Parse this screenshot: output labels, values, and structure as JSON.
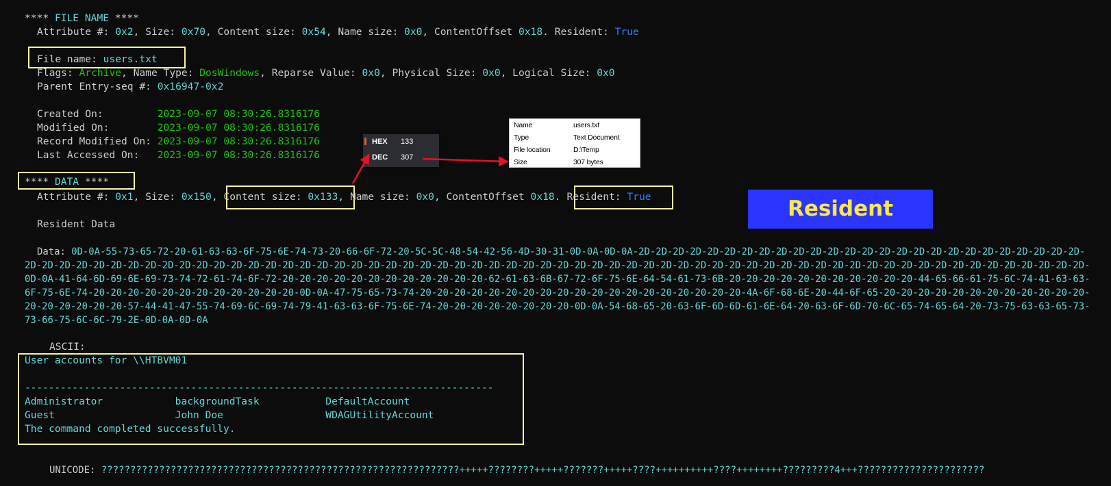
{
  "file_name_section": {
    "header_stars_open": "**** ",
    "header_label": "FILE NAME",
    "header_stars_close": " ****",
    "attr_line": {
      "attribute_label": "Attribute #: ",
      "attribute": "0x2",
      "size_label": ", Size: ",
      "size": "0x70",
      "content_size_label": ", Content size: ",
      "content_size": "0x54",
      "name_size_label": ", Name size: ",
      "name_size": "0x0",
      "content_offset_label": ", ContentOffset ",
      "content_offset": "0x18",
      "resident_label": ". Resident: ",
      "resident": "True"
    },
    "file_name_label": "File name: ",
    "file_name": "users.txt",
    "flags_label": "Flags: ",
    "flags": "Archive",
    "name_type_label": ", Name Type: ",
    "name_type": "DosWindows",
    "reparse_label": ", Reparse Value: ",
    "reparse": "0x0",
    "physical_label": ", Physical Size: ",
    "physical": "0x0",
    "logical_label": ", Logical Size: ",
    "logical": "0x0",
    "parent_label": "Parent Entry-seq #: ",
    "parent": "0x16947-0x2",
    "timestamps": [
      {
        "label": "Created On:         ",
        "value": "2023-09-07 08:30:26.8316176"
      },
      {
        "label": "Modified On:        ",
        "value": "2023-09-07 08:30:26.8316176"
      },
      {
        "label": "Record Modified On: ",
        "value": "2023-09-07 08:30:26.8316176"
      },
      {
        "label": "Last Accessed On:   ",
        "value": "2023-09-07 08:30:26.8316176"
      }
    ]
  },
  "data_section": {
    "header_stars_open": "**** ",
    "header_label": "DATA",
    "header_stars_close": " ****",
    "attr_line": {
      "attribute_label": "Attribute #: ",
      "attribute": "0x1",
      "size_label": ", Size: ",
      "size": "0x150",
      "sep1": ", ",
      "content_size_label": "Content size: ",
      "content_size": "0x133",
      "sep2": ",",
      "name_size_label": " Name size: ",
      "name_size": "0x0",
      "content_offset_label": ", ContentOffset ",
      "content_offset": "0x18",
      "sep3": ".",
      "resident_label": "Resident: ",
      "resident": "True"
    },
    "resident_data_label": "Resident Data",
    "data_label": "Data: ",
    "data_hex": "0D-0A-55-73-65-72-20-61-63-63-6F-75-6E-74-73-20-66-6F-72-20-5C-5C-48-54-42-56-4D-30-31-0D-0A-0D-0A-2D-2D-2D-2D-2D-2D-2D-2D-2D-2D-2D-2D-2D-2D-2D-2D-2D-2D-2D-2D-2D-2D-2D-2D-2D-2D-2D-2D-2D-2D-2D-2D-2D-2D-2D-2D-2D-2D-2D-2D-2D-2D-2D-2D-2D-2D-2D-2D-2D-2D-2D-2D-2D-2D-2D-2D-2D-2D-2D-2D-2D-2D-2D-2D-2D-2D-2D-2D-2D-2D-2D-2D-2D-2D-2D-2D-2D-2D-2D-2D-2D-2D-2D-2D-2D-2D-2D-2D-0D-0A-41-64-6D-69-6E-69-73-74-72-61-74-6F-72-20-20-20-20-20-20-20-20-20-20-20-20-62-61-63-6B-67-72-6F-75-6E-64-54-61-73-6B-20-20-20-20-20-20-20-20-20-20-20-44-65-66-61-75-6C-74-41-63-63-6F-75-6E-74-20-20-20-20-20-20-20-20-20-20-20-20-0D-0A-47-75-65-73-74-20-20-20-20-20-20-20-20-20-20-20-20-20-20-20-20-20-20-20-4A-6F-68-6E-20-44-6F-65-20-20-20-20-20-20-20-20-20-20-20-20-20-20-20-20-20-20-57-44-41-47-55-74-69-6C-69-74-79-41-63-63-6F-75-6E-74-20-20-20-20-20-20-20-20-0D-0A-54-68-65-20-63-6F-6D-6D-61-6E-64-20-63-6F-6D-70-6C-65-74-65-64-20-73-75-63-63-65-73-73-66-75-6C-6C-79-2E-0D-0A-0D-0A",
    "ascii_label": "ASCII:",
    "ascii_lines": [
      "User accounts for \\\\HTBVM01",
      "",
      "-------------------------------------------------------------------------------",
      "Administrator            backgroundTask           DefaultAccount",
      "Guest                    John Doe                 WDAGUtilityAccount",
      "The command completed successfully."
    ],
    "unicode_label": "UNICODE: ",
    "unicode_value": "??????????????????????????????????????????????????????????????+++++????????+++++???????+++++????++++++++++????++++++++?????????4+++??????????????????????"
  },
  "hex_popup": {
    "hex_label": "HEX",
    "hex_value": "133",
    "dec_label": "DEC",
    "dec_value": "307"
  },
  "properties_popup": {
    "rows": [
      {
        "label": "Name",
        "value": "users.txt"
      },
      {
        "label": "Type",
        "value": "Text Document"
      },
      {
        "label": "File location",
        "value": "D:\\Temp"
      },
      {
        "label": "Size",
        "value": "307 bytes"
      }
    ]
  },
  "resident_badge": "Resident",
  "colors": {
    "background": "#0c0c0c",
    "text": "#cccccc",
    "cyan": "#61d6d6",
    "green": "#16c60c",
    "blue": "#3b78ff",
    "highlight_box": "#f9f1a5",
    "badge_bg": "#2b35ff",
    "badge_text": "#ffe74a",
    "arrow": "#e81123"
  }
}
